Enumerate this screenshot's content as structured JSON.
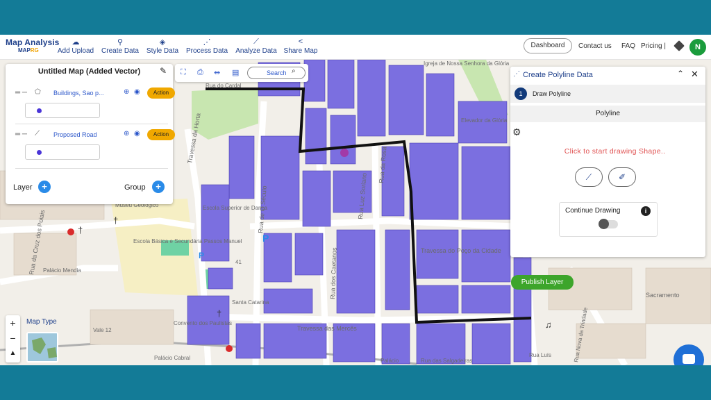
{
  "app": {
    "logo_title": "Map Analysis",
    "logo_sub_a": "MAP",
    "logo_sub_b": "RG"
  },
  "nav": {
    "items": [
      {
        "label": "Add Upload",
        "icon": "cloud-upload-icon"
      },
      {
        "label": "Create Data",
        "icon": "map-pin-icon"
      },
      {
        "label": "Style Data",
        "icon": "paint-bucket-icon"
      },
      {
        "label": "Process Data",
        "icon": "process-nodes-icon"
      },
      {
        "label": "Analyze Data",
        "icon": "analyze-icon"
      },
      {
        "label": "Share Map",
        "icon": "share-icon"
      }
    ],
    "dashboard": "Dashboard",
    "contact": "Contact us",
    "faq": "FAQ",
    "pricing": "Pricing |",
    "avatar_initial": "N"
  },
  "layer_panel": {
    "title": "Untitled Map (Added Vector)",
    "layers": [
      {
        "name": "Buildings, Sao p...",
        "type_icon": "polygon-icon",
        "action": "Action"
      },
      {
        "name": "Proposed Road",
        "type_icon": "polyline-icon",
        "action": "Action"
      }
    ],
    "layer_label": "Layer",
    "group_label": "Group"
  },
  "toolbar": {
    "search_label": "Search"
  },
  "poly_panel": {
    "title": "Create Polyline Data",
    "step_number": "1",
    "step_label": "Draw Polyline",
    "tab_label": "Polyline",
    "hint": "Click to start drawing Shape..",
    "continue_label": "Continue Drawing",
    "publish_label": "Publish Layer"
  },
  "map_controls": {
    "zoom_in": "+",
    "zoom_out": "−",
    "map_type": "Map Type"
  },
  "map_labels": {
    "travessa_da_horta": "Travessa da Horta",
    "rua_do_seculo": "Rua de O Século",
    "rua_da_rosa": "Rua da Rosa",
    "rua_luz_soriano": "Rua Luz Soriano",
    "rua_dos_caetanos": "Rua dos Caetanos",
    "travessa_das_merces": "Travessa das Mercês",
    "travessa_poco": "Travessa do Poço da Cidade",
    "rua_cruz_dos_poiais": "Rua da Cruz dos Poiais",
    "palacio_mendia": "Palácio Mendia",
    "museu_geologico": "Museu Geológico",
    "escola_basica": "Escola Básica e Secundária Passos Manuel",
    "escola_superior": "Escola Superior de Dança",
    "convento_paulistas": "Convento dos Paulistas",
    "vale_12": "Vale 12",
    "sacramento": "Sacramento",
    "rua_salgadeiras": "Rua das Salgadeiras",
    "rua_nova_trindade": "Rua Nova da Trindade",
    "elevador_gloria": "Elevador da Glória",
    "igreja_gloria": "Igreja de Nossa Senhora da Glória",
    "rua_do_cardal": "Rua do Cardal",
    "santa_catarina": "Santa Catarina",
    "palacio_cabral": "Palácio Cabral",
    "num_41": "41",
    "rua_luis": "Rua Luís",
    "palacio_short": "Palácio"
  },
  "colors": {
    "building_fill": "#7b6fe0",
    "road_line": "#111111",
    "accent_blue": "#1e3f8a",
    "action_orange": "#f0a800",
    "publish_green": "#3da52b"
  }
}
